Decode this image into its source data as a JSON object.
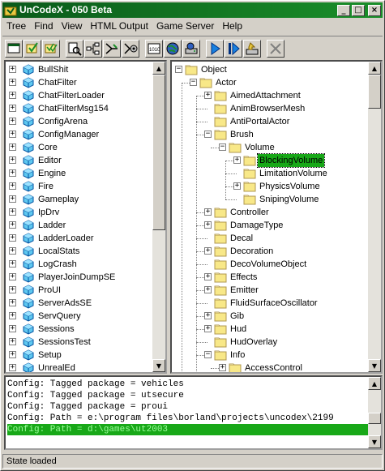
{
  "window": {
    "title": "UnCodeX - 050 Beta"
  },
  "menu": [
    "Tree",
    "Find",
    "View",
    "HTML Output",
    "Game Server",
    "Help"
  ],
  "toolbar": {
    "icons": [
      "window-icon",
      "tree-check-icon",
      "tree-check-all-icon",
      "find-class-icon",
      "tree-node-icon",
      "tree-branch-icon",
      "tree-settings-icon",
      "html-output-icon",
      "globe-icon",
      "server-icon",
      "run-icon",
      "step-icon",
      "compile-icon",
      "close-icon"
    ]
  },
  "left_tree": {
    "items": [
      "BullShit",
      "ChatFilter",
      "ChatFilterLoader",
      "ChatFilterMsg154",
      "ConfigArena",
      "ConfigManager",
      "Core",
      "Editor",
      "Engine",
      "Fire",
      "Gameplay",
      "IpDrv",
      "Ladder",
      "LadderLoader",
      "LocalStats",
      "LogCrash",
      "PlayerJoinDumpSE",
      "ProUI",
      "ServerAdsSE",
      "ServQuery",
      "Sessions",
      "SessionsTest",
      "Setup",
      "UnrealEd"
    ]
  },
  "right_tree": {
    "items": [
      {
        "label": "Object",
        "level": 0,
        "expander": "minus"
      },
      {
        "label": "Actor",
        "level": 1,
        "expander": "minus"
      },
      {
        "label": "AimedAttachment",
        "level": 2,
        "expander": "plus"
      },
      {
        "label": "AnimBrowserMesh",
        "level": 2,
        "expander": "none"
      },
      {
        "label": "AntiPortalActor",
        "level": 2,
        "expander": "none"
      },
      {
        "label": "Brush",
        "level": 2,
        "expander": "minus"
      },
      {
        "label": "Volume",
        "level": 3,
        "expander": "minus"
      },
      {
        "label": "BlockingVolume",
        "level": 4,
        "expander": "plus",
        "selected": true
      },
      {
        "label": "LimitationVolume",
        "level": 4,
        "expander": "none"
      },
      {
        "label": "PhysicsVolume",
        "level": 4,
        "expander": "plus"
      },
      {
        "label": "SnipingVolume",
        "level": 4,
        "expander": "none"
      },
      {
        "label": "Controller",
        "level": 2,
        "expander": "plus"
      },
      {
        "label": "DamageType",
        "level": 2,
        "expander": "plus"
      },
      {
        "label": "Decal",
        "level": 2,
        "expander": "none"
      },
      {
        "label": "Decoration",
        "level": 2,
        "expander": "plus"
      },
      {
        "label": "DecoVolumeObject",
        "level": 2,
        "expander": "none"
      },
      {
        "label": "Effects",
        "level": 2,
        "expander": "plus"
      },
      {
        "label": "Emitter",
        "level": 2,
        "expander": "plus"
      },
      {
        "label": "FluidSurfaceOscillator",
        "level": 2,
        "expander": "none"
      },
      {
        "label": "Gib",
        "level": 2,
        "expander": "plus"
      },
      {
        "label": "Hud",
        "level": 2,
        "expander": "plus"
      },
      {
        "label": "HudOverlay",
        "level": 2,
        "expander": "none"
      },
      {
        "label": "Info",
        "level": 2,
        "expander": "minus"
      },
      {
        "label": "AccessControl",
        "level": 3,
        "expander": "plus"
      }
    ]
  },
  "log": {
    "lines": [
      "Config: Tagged package = vehicles",
      "Config: Tagged package = utsecure",
      "Config: Tagged package = proui",
      "Config: Path = e:\\program files\\borland\\projects\\uncodex\\2199",
      "Config: Path = d:\\games\\ut2003"
    ],
    "selected_index": 4
  },
  "status": {
    "text": "State loaded"
  },
  "colors": {
    "title_start": "#0a5a1a",
    "title_end": "#1a8f2a",
    "selection": "#18a818",
    "folder": "#f8e888"
  }
}
